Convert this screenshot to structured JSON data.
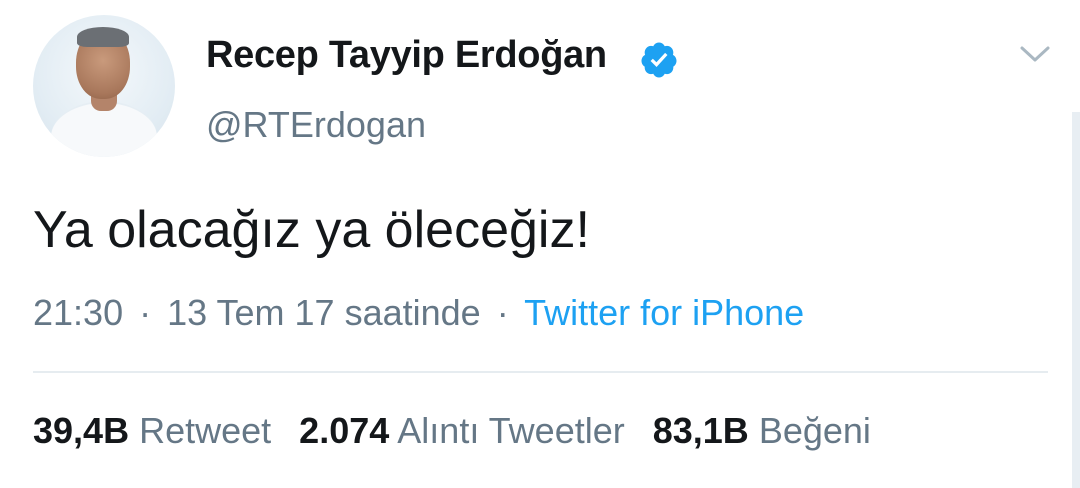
{
  "author": {
    "name": "Recep Tayyip Erdoğan",
    "handle": "@RTErdogan",
    "verified": true
  },
  "tweet": {
    "text": "Ya olacağız ya öleceğiz!",
    "time": "21:30",
    "date": "13 Tem 17 saatinde",
    "separator": "·",
    "source": "Twitter for iPhone"
  },
  "stats": {
    "retweets_count": "39,4B",
    "retweets_label": "Retweet",
    "quotes_count": "2.074",
    "quotes_label": "Alıntı Tweetler",
    "likes_count": "83,1B",
    "likes_label": "Beğeni"
  },
  "icons": {
    "verified": "verified-badge-icon",
    "menu": "chevron-down-icon"
  },
  "colors": {
    "accent": "#1da1f2",
    "secondary_text": "#657786",
    "primary_text": "#14171a",
    "divider": "#e6ecf0"
  }
}
